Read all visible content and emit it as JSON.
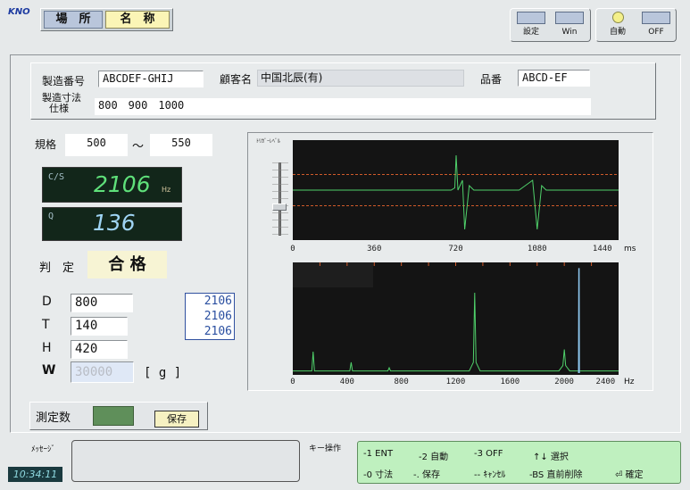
{
  "header": {
    "logo": "KNO",
    "tab_location": "場　所",
    "tab_name": "名　称",
    "btn_settings": "設定",
    "btn_win": "Win",
    "btn_auto": "自動",
    "btn_off": "OFF"
  },
  "info": {
    "serial_label": "製造番号",
    "serial_value": "ABCDEF-GHIJ",
    "customer_label": "顧客名",
    "customer_value": "中国北辰(有)",
    "part_label": "品番",
    "part_value": "ABCD-EF",
    "dims_label_line1": "製造寸法",
    "dims_label_line2": "仕様",
    "dims_value": "800　900　1000"
  },
  "spec": {
    "label": "規格",
    "min": "500",
    "sep": "～",
    "max": "550"
  },
  "cs_display": {
    "label": "C/S",
    "value": "2106",
    "unit": "Hz"
  },
  "q_display": {
    "label": "Q",
    "value": "136"
  },
  "judgement": {
    "label": "判　定",
    "value": "合 格"
  },
  "params": {
    "d_label": "D",
    "d_value": "800",
    "t_label": "T",
    "t_value": "140",
    "h_label": "H",
    "h_value": "420",
    "w_label": "W",
    "w_value": "30000",
    "w_unit": "[ g ]"
  },
  "freq_list": [
    "2106",
    "2106",
    "2106"
  ],
  "count": {
    "label": "測定数",
    "save_button": "保存"
  },
  "status": {
    "message_label": "ﾒｯｾｰｼﾞ",
    "time": "10:34:11",
    "key_ops_label": "キー操作"
  },
  "key_help": {
    "row1": [
      "-1 ENT",
      "-2 自動",
      "-3 OFF",
      "↑↓ 選択"
    ],
    "row2": [
      "-0 寸法",
      "-. 保存",
      "-- ｷｬﾝｾﾙ",
      "-BS 直前削除",
      "⏎ 確定"
    ]
  },
  "colors": {
    "trace": "#4fd06a",
    "threshold": "#d05a2a",
    "peak_highlight": "#8ec8f0",
    "cs_value": "#5fe07a",
    "q_value": "#9fd4f4",
    "freq_text": "#2a4fa0",
    "count_box": "#5f8f5a",
    "help_bg": "#bff0bf"
  },
  "chart_data": [
    {
      "type": "line",
      "title": "",
      "ylabel": "ﾄﾘｶﾞｰﾚﾍﾞﾙ",
      "x_unit": "ms",
      "x_ticks": [
        "0",
        "360",
        "720",
        "1080",
        "1440"
      ],
      "xlim": [
        0,
        1440
      ],
      "ylim": [
        -1,
        1
      ],
      "threshold_levels": [
        0.35,
        -0.35
      ],
      "series": [
        {
          "x": [
            0,
            700,
            716,
            722,
            730,
            750,
            760,
            780,
            800,
            1000,
            1060,
            1080,
            1100,
            1120,
            1440
          ],
          "y": [
            0,
            0,
            0.05,
            0.78,
            0,
            0.22,
            -0.88,
            0.1,
            0,
            0,
            0.22,
            -0.88,
            0.1,
            0,
            0
          ]
        }
      ]
    },
    {
      "type": "line",
      "title": "",
      "x_unit": "Hz",
      "x_ticks": [
        "0",
        "400",
        "800",
        "1200",
        "1600",
        "2000",
        "2400"
      ],
      "xlim": [
        0,
        2400
      ],
      "ylim": [
        0,
        1
      ],
      "series": [
        {
          "x": [
            0,
            140,
            150,
            160,
            420,
            430,
            440,
            700,
            710,
            720,
            1300,
            1330,
            1340,
            1350,
            1380,
            1960,
            1990,
            2000,
            2010,
            2040,
            2400
          ],
          "y": [
            0.02,
            0.02,
            0.2,
            0.02,
            0.02,
            0.1,
            0.02,
            0.02,
            0.05,
            0.02,
            0.02,
            0.1,
            0.75,
            0.1,
            0.02,
            0.02,
            0.07,
            0.22,
            0.07,
            0.02,
            0.02
          ]
        },
        {
          "name": "",
          "x": [
            2106,
            2108,
            2110
          ],
          "y": [
            0,
            0.98,
            0
          ]
        }
      ]
    }
  ]
}
